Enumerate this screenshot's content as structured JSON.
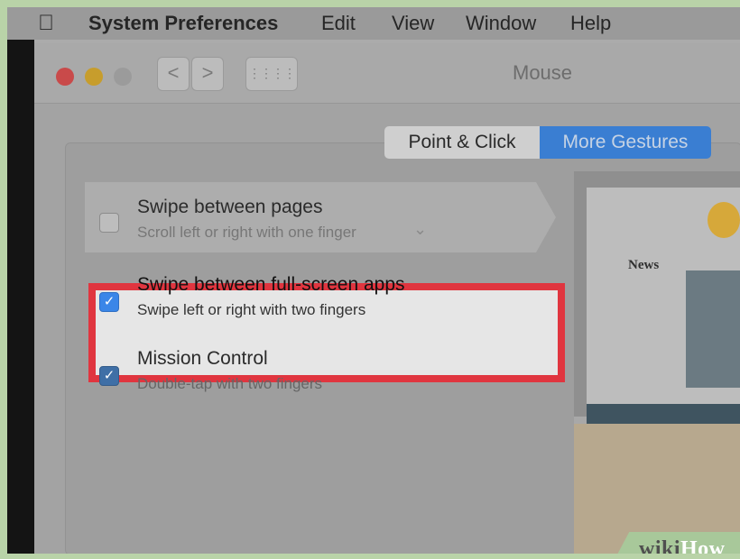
{
  "menubar": {
    "app_name": "System Preferences",
    "items": [
      "Edit",
      "View",
      "Window",
      "Help"
    ]
  },
  "window": {
    "title": "Mouse",
    "nav_back": "<",
    "nav_forward": ">",
    "grid_button": "⋮⋮⋮⋮"
  },
  "tabs": [
    {
      "label": "Point & Click",
      "selected": false
    },
    {
      "label": "More Gestures",
      "selected": true
    }
  ],
  "options": [
    {
      "title": "Swipe between pages",
      "subtitle": "Scroll left or right with one finger",
      "dropdown": "⌄",
      "checked": false
    },
    {
      "title": "Swipe between full-screen apps",
      "subtitle": "Swipe left or right with two fingers",
      "checked": true,
      "highlighted": true
    },
    {
      "title": "Mission Control",
      "subtitle": "Double-tap with two fingers",
      "checked": true
    }
  ],
  "preview": {
    "site_heading": "News",
    "dock": "dock"
  },
  "watermark": {
    "wiki": "wiki",
    "how": "How"
  },
  "colors": {
    "highlight_border": "#e0353f",
    "accent": "#3a7ed2",
    "watermark": "#a8c89a"
  }
}
